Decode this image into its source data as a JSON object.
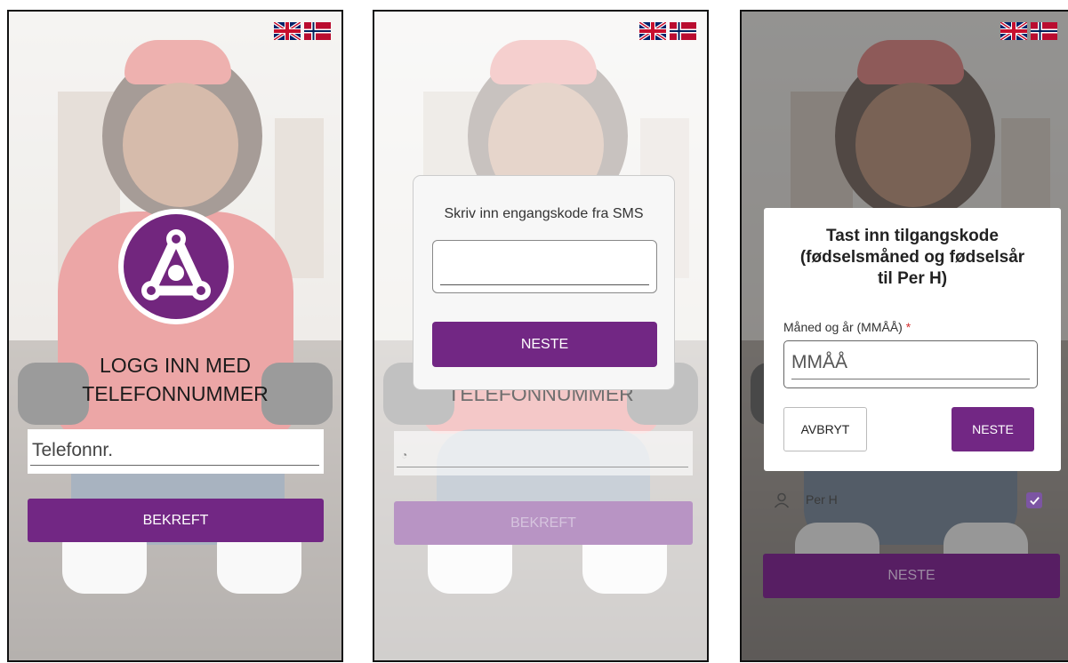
{
  "screen1": {
    "title_line1": "LOGG INN MED",
    "title_line2": "TELEFONNUMMER",
    "phone_placeholder": "Telefonnr.",
    "confirm_label": "BEKREFT"
  },
  "screen2": {
    "title_line2": "TELEFONNUMMER",
    "dialog_title": "Skriv inn engangskode fra SMS",
    "next_label": "NESTE",
    "confirm_label": "BEKREFT"
  },
  "screen3": {
    "dialog_title_line1": "Tast inn tilgangskode",
    "dialog_title_line2": "(fødselsmåned og fødselsår",
    "dialog_title_line3": "til Per H)",
    "field_label": "Måned og år (MMÅÅ)",
    "required_mark": "*",
    "field_placeholder": "MMÅÅ",
    "cancel_label": "AVBRYT",
    "next_label": "NESTE",
    "user_name": "Per H",
    "user_checked": true,
    "bottom_next_label": "NESTE"
  },
  "icons": [
    "flag-uk-icon",
    "flag-norway-icon",
    "app-logo-icon",
    "user-icon",
    "checkbox-checked-icon",
    "clock-icon"
  ],
  "colors": {
    "accent": "#722784",
    "accent_disabled": "#b894c4",
    "required": "#d32f2f"
  }
}
